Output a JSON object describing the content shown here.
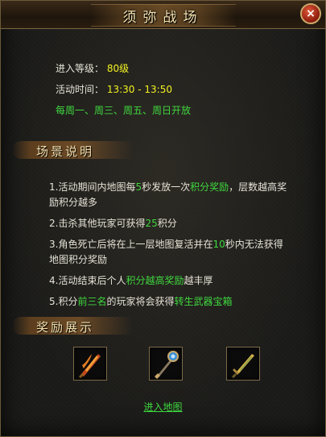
{
  "window": {
    "title": "须弥战场",
    "close_label": "×"
  },
  "info": {
    "level_label": "进入等级：",
    "level_value": "80级",
    "time_label": "活动时间：",
    "time_value": "13:30 - 13:50",
    "days": "每周一、周三、周五、周日开放"
  },
  "scene": {
    "heading": "场景说明",
    "rules": [
      {
        "parts": [
          {
            "t": "1.活动期间内地图每"
          },
          {
            "t": "5",
            "hl": true
          },
          {
            "t": "秒发放一次"
          },
          {
            "t": "积分奖励",
            "hl": true
          },
          {
            "t": "，层数越高奖励积分越多"
          }
        ]
      },
      {
        "parts": [
          {
            "t": "2.击杀其他玩家可获得"
          },
          {
            "t": "25",
            "hl": true
          },
          {
            "t": "积分"
          }
        ]
      },
      {
        "parts": [
          {
            "t": "3.角色死亡后将在上一层地图复活并在"
          },
          {
            "t": "10",
            "hl": true
          },
          {
            "t": "秒内无法获得地图积分奖励"
          }
        ]
      },
      {
        "parts": [
          {
            "t": "4.活动结束后个人"
          },
          {
            "t": "积分越高奖励",
            "hl": true
          },
          {
            "t": "越丰厚"
          }
        ]
      },
      {
        "parts": [
          {
            "t": "5.积分"
          },
          {
            "t": "前三名",
            "hl": true
          },
          {
            "t": "的玩家将会获得"
          },
          {
            "t": "转生武器宝箱",
            "hl": true
          }
        ]
      }
    ]
  },
  "rewards": {
    "heading": "奖励展示",
    "items": [
      {
        "icon": "flame-blade-icon"
      },
      {
        "icon": "jeweled-staff-icon"
      },
      {
        "icon": "golden-sword-icon"
      }
    ]
  },
  "enter_link": "进入地图",
  "colors": {
    "highlight": "#3fd83f",
    "level": "#f2f222",
    "title": "#f4e4b0"
  }
}
